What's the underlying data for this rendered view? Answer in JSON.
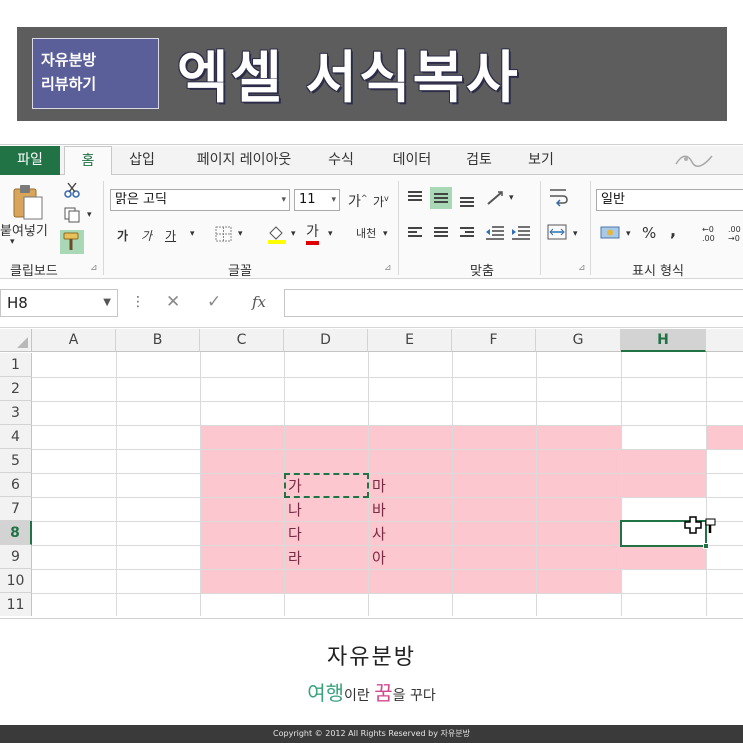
{
  "banner": {
    "tag_line1": "자유분방",
    "tag_line2": "리뷰하기",
    "title": "엑셀 서식복사"
  },
  "ribbon": {
    "tabs": [
      {
        "label": "파일"
      },
      {
        "label": "홈"
      },
      {
        "label": "삽입"
      },
      {
        "label": "페이지 레이아웃"
      },
      {
        "label": "수식"
      },
      {
        "label": "데이터"
      },
      {
        "label": "검토"
      },
      {
        "label": "보기"
      }
    ],
    "active_tab": "홈",
    "clipboard": {
      "paste_label": "붙여넣기",
      "group_label": "클립보드"
    },
    "font": {
      "name": "맑은 고딕",
      "size": "11",
      "grow": "가",
      "shrink": "가",
      "bold": "가",
      "italic": "가",
      "underline": "가",
      "font_color_glyph": "가",
      "phonetic": "내천",
      "group_label": "글꼴"
    },
    "alignment": {
      "group_label": "맞춤"
    },
    "number": {
      "format": "일반",
      "percent": "%",
      "comma": ",",
      "group_label": "표시 형식"
    }
  },
  "formula_bar": {
    "name_box": "H8",
    "dots": "⋮",
    "cancel": "✕",
    "enter": "✓",
    "fx": "fx",
    "value": ""
  },
  "sheet": {
    "columns": [
      "A",
      "B",
      "C",
      "D",
      "E",
      "F",
      "G",
      "H"
    ],
    "rows": [
      "1",
      "2",
      "3",
      "4",
      "5",
      "6",
      "7",
      "8",
      "9",
      "10",
      "11"
    ],
    "selected_column": "H",
    "selected_row": "8",
    "cells": {
      "D6": "가",
      "D7": "나",
      "D8": "다",
      "D9": "라",
      "E6": "마",
      "E7": "바",
      "E8": "사",
      "E9": "아"
    },
    "fill_color": "#fdc7d0",
    "copied_range": "D6",
    "active_cell": "H8"
  },
  "footer": {
    "name": "자유분방",
    "slogan_1": "여행",
    "slogan_2": "이란 ",
    "slogan_3": "꿈",
    "slogan_4": "을 꾸다",
    "copyright": "Copyright © 2012 All Rights Reserved by 자유분방"
  },
  "colors": {
    "excel_green": "#217346",
    "banner_bg": "#5d5d5d",
    "tag_bg": "#5b5f99",
    "cell_fill": "#fdc7d0"
  }
}
